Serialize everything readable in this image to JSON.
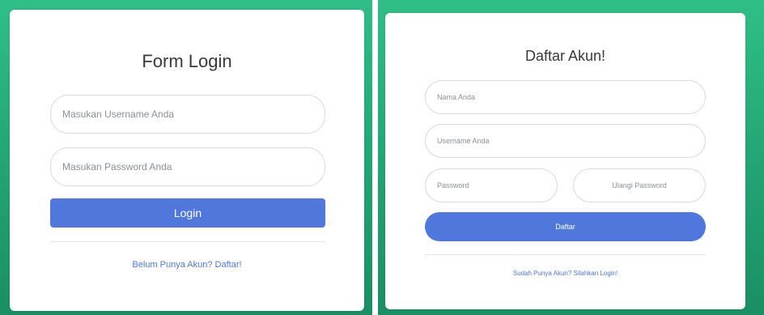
{
  "login": {
    "title": "Form Login",
    "username_placeholder": "Masukan Username Anda",
    "password_placeholder": "Masukan Password Anda",
    "login_label": "Login",
    "register_link": "Belum Punya Akun? Daftar!"
  },
  "register": {
    "title": "Daftar Akun!",
    "name_placeholder": "Nama Anda",
    "username_placeholder": "Username Anda",
    "password_placeholder": "Password",
    "repeat_password_placeholder": "Ulangi Password",
    "register_label": "Daftar",
    "login_link": "Sudah Punya Akun? Silahkan Login!"
  },
  "colors": {
    "accent": "#4f77dc",
    "frame_green": "#24a877"
  }
}
